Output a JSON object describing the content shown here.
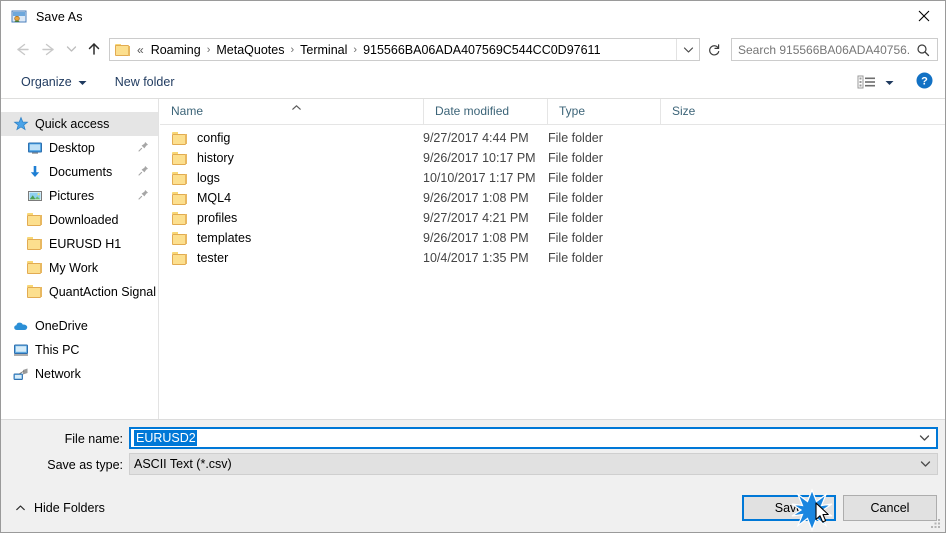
{
  "window": {
    "title": "Save As",
    "title_icon": "save-as-app-icon",
    "close_icon": "close-icon"
  },
  "navigation": {
    "back_icon": "back-arrow-icon",
    "forward_icon": "forward-arrow-icon",
    "recent_icon": "chevron-down-icon",
    "up_icon": "up-arrow-icon",
    "refresh_icon": "refresh-icon",
    "address_dropdown_icon": "chevron-down-icon",
    "folder_icon": "folder-icon",
    "overflow": "«",
    "breadcrumbs": [
      "Roaming",
      "MetaQuotes",
      "Terminal",
      "915566BA06ADA407569C544CC0D97611"
    ],
    "separator": "›"
  },
  "search": {
    "placeholder": "Search 915566BA06ADA40756...",
    "value": "",
    "icon": "search-icon"
  },
  "toolbar": {
    "organize_label": "Organize",
    "organize_caret_icon": "caret-down-icon",
    "new_folder_label": "New folder",
    "view_icon": "view-layout-icon",
    "view_caret_icon": "caret-down-icon",
    "help_icon": "help-question-icon"
  },
  "sidebar": {
    "items": [
      {
        "label": "Quick access",
        "icon": "star-icon",
        "selected": true,
        "root": true,
        "pinned": false
      },
      {
        "label": "Desktop",
        "icon": "desktop-monitor-icon",
        "selected": false,
        "root": false,
        "pinned": true
      },
      {
        "label": "Documents",
        "icon": "documents-arrow-icon",
        "selected": false,
        "root": false,
        "pinned": true
      },
      {
        "label": "Pictures",
        "icon": "pictures-icon",
        "selected": false,
        "root": false,
        "pinned": true
      },
      {
        "label": "Downloaded",
        "icon": "folder-icon",
        "selected": false,
        "root": false,
        "pinned": false
      },
      {
        "label": "EURUSD H1",
        "icon": "folder-icon",
        "selected": false,
        "root": false,
        "pinned": false
      },
      {
        "label": "My Work",
        "icon": "folder-icon",
        "selected": false,
        "root": false,
        "pinned": false
      },
      {
        "label": "QuantAction Signal",
        "icon": "folder-icon",
        "selected": false,
        "root": false,
        "pinned": false
      },
      {
        "label": "OneDrive",
        "icon": "onedrive-cloud-icon",
        "selected": false,
        "root": true,
        "pinned": false
      },
      {
        "label": "This PC",
        "icon": "this-pc-icon",
        "selected": false,
        "root": true,
        "pinned": false
      },
      {
        "label": "Network",
        "icon": "network-icon",
        "selected": false,
        "root": true,
        "pinned": false
      }
    ]
  },
  "filelist": {
    "columns": [
      "Name",
      "Date modified",
      "Type",
      "Size"
    ],
    "sort_column": "Name",
    "sort_direction": "ascending",
    "sort_icon": "chevron-up-icon",
    "rows": [
      {
        "name": "config",
        "date": "9/27/2017 4:44 PM",
        "type": "File folder",
        "size": "",
        "icon": "folder-icon"
      },
      {
        "name": "history",
        "date": "9/26/2017 10:17 PM",
        "type": "File folder",
        "size": "",
        "icon": "folder-icon"
      },
      {
        "name": "logs",
        "date": "10/10/2017 1:17 PM",
        "type": "File folder",
        "size": "",
        "icon": "folder-icon"
      },
      {
        "name": "MQL4",
        "date": "9/26/2017 1:08 PM",
        "type": "File folder",
        "size": "",
        "icon": "folder-icon"
      },
      {
        "name": "profiles",
        "date": "9/27/2017 4:21 PM",
        "type": "File folder",
        "size": "",
        "icon": "folder-icon"
      },
      {
        "name": "templates",
        "date": "9/26/2017 1:08 PM",
        "type": "File folder",
        "size": "",
        "icon": "folder-icon"
      },
      {
        "name": "tester",
        "date": "10/4/2017 1:35 PM",
        "type": "File folder",
        "size": "",
        "icon": "folder-icon"
      }
    ]
  },
  "form": {
    "filename_label": "File name:",
    "filename_value": "EURUSD2",
    "filename_selected": true,
    "filetype_label": "Save as type:",
    "filetype_value": "ASCII Text (*.csv)",
    "dropdown_icon": "chevron-down-icon"
  },
  "footer": {
    "hide_folders_label": "Hide Folders",
    "hide_folders_icon": "chevron-up-icon",
    "save_label": "Save",
    "cancel_label": "Cancel",
    "resize_grip_icon": "resize-grip-icon",
    "cursor_icon": "mouse-pointer-icon",
    "click_burst_icon": "click-burst-icon"
  },
  "colors": {
    "accent": "#0078d7",
    "folder": "#fcdf8e",
    "column_header_text": "#3c6478",
    "selection": "#e5e5e5",
    "dialog_bg": "#f0f0f0"
  }
}
